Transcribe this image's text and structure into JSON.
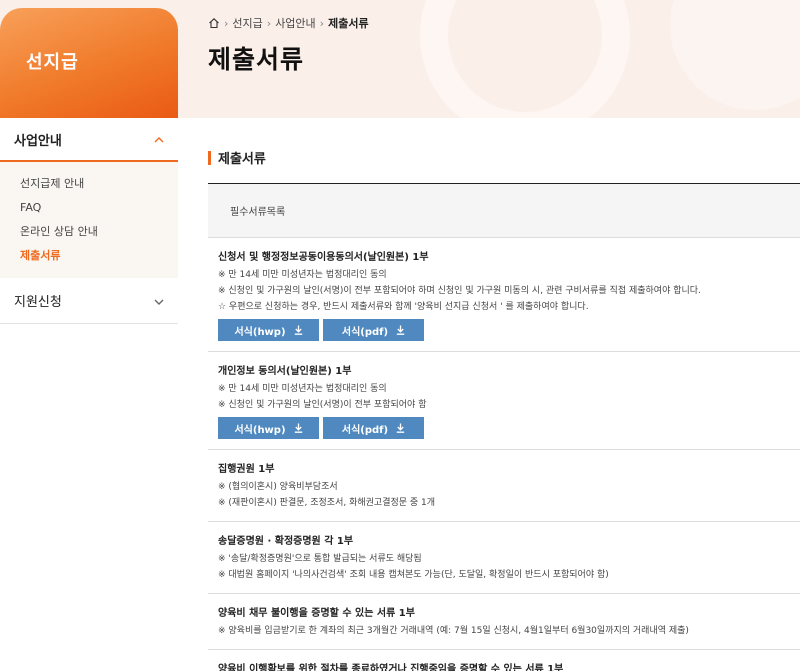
{
  "sidebar": {
    "banner_title": "선지급",
    "menu1_label": "사업안내",
    "menu1_items": [
      "선지급제 안내",
      "FAQ",
      "온라인 상담 안내",
      "제출서류"
    ],
    "menu2_label": "지원신청"
  },
  "breadcrumb": [
    "선지급",
    "사업안내",
    "제출서류"
  ],
  "page_title": "제출서류",
  "section_title": "제출서류",
  "table_head": "필수서류목록",
  "docs": [
    {
      "title": "신청서 및 행정정보공동이용동의서(날인원본) 1부",
      "notes": [
        "※ 만 14세 미만 미성년자는 법정대리인 동의",
        "※ 신청인 및 가구원의 날인(서명)이 전부 포함되어야 하며 신청인 및 가구원 미동의 시, 관련 구비서류를 직접 제출하여야 합니다.",
        "☆ 우편으로 신청하는 경우, 반드시 제출서류와 함께 '양육비 선지급 신청서 ' 를 제출하여야 합니다."
      ],
      "btn_hwp": "서식(hwp)",
      "btn_pdf": "서식(pdf)"
    },
    {
      "title": "개인정보 동의서(날인원본) 1부",
      "notes": [
        "※ 만 14세 미만 미성년자는 법정대리인 동의",
        "※ 신청인 및 가구원의 날인(서명)이 전부 포함되어야 함"
      ],
      "btn_hwp": "서식(hwp)",
      "btn_pdf": "서식(pdf)"
    },
    {
      "title": "집행권원 1부",
      "notes": [
        "※ (협의이혼시) 양육비부담조서",
        "※ (재판이혼시) 판결문, 조정조서, 화해권고결정문 중 1개"
      ]
    },
    {
      "title": "송달증명원 · 확정증명원 각 1부",
      "notes": [
        "※ '송달/확정증명원'으로 통합 발급되는 서류도 해당됨",
        "※ 대법원 홈페이지 '나의사건검색' 조회 내용 캡쳐본도 가능(단, 도달일, 확정일이 반드시 포함되어야 함)"
      ]
    },
    {
      "title": "양육비 채무 불이행을 증명할 수 있는 서류 1부",
      "notes": [
        "※ 양육비를 입금받기로 한 계좌의 최근 3개월간 거래내역 (예: 7월 15일 신청시, 4월1일부터 6월30일까지의 거래내역 제출)"
      ]
    },
    {
      "title": "양육비 이행확보를 위한 절차를 종료하였거나 진행중임을 증명할 수 있는 서류 1부",
      "notes": []
    }
  ],
  "colors": {
    "accent": "#ef6a1e",
    "button": "#4f89c0",
    "hero_bg": "#fbefe9"
  }
}
